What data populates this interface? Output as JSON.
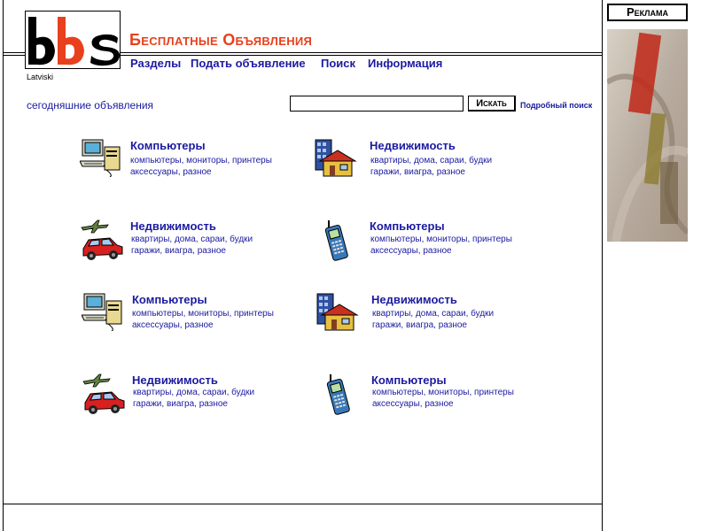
{
  "header": {
    "logo_text": "bbs",
    "site_title": "Бесплатные Объявления",
    "language": "Latviski"
  },
  "nav": [
    {
      "label": "Разделы"
    },
    {
      "label": "Подать объявление"
    },
    {
      "label": "Поиск"
    },
    {
      "label": "Информация"
    }
  ],
  "search": {
    "today_label": "сегодняшние объявления",
    "value": "",
    "button_label": "Искать",
    "advanced_label": "Подробный поиск"
  },
  "categories": [
    {
      "title": "Компьютеры",
      "line1": "компьютеры, мониторы, принтеры",
      "line2": "аксессуары, разное",
      "icon": "computer-icon"
    },
    {
      "title": "Недвижимость",
      "line1": "квартиры, дома, сараи, будки",
      "line2": "гаражи, виагра, разное",
      "icon": "house-icon"
    },
    {
      "title": "Недвижимость",
      "line1": "квартиры, дома, сараи, будки",
      "line2": "гаражи, виагра, разное",
      "icon": "car-plane-icon"
    },
    {
      "title": "Компьютеры",
      "line1": "компьютеры, мониторы, принтеры",
      "line2": "аксессуары, разное",
      "icon": "mobile-phone-icon"
    },
    {
      "title": "Компьютеры",
      "line1": "компьютеры, мониторы, принтеры",
      "line2": "аксессуары, разное",
      "icon": "computer-icon"
    },
    {
      "title": "Недвижимость",
      "line1": "квартиры, дома, сараи, будки",
      "line2": "гаражи, виагра, разное",
      "icon": "house-icon"
    },
    {
      "title": "Недвижимость",
      "line1": "квартиры, дома, сараи, будки",
      "line2": "гаражи, виагра, разное",
      "icon": "car-plane-icon"
    },
    {
      "title": "Компьютеры",
      "line1": "компьютеры, мониторы, принтеры",
      "line2": "аксессуары, разное",
      "icon": "mobile-phone-icon"
    }
  ],
  "ad": {
    "title": "Реклама"
  },
  "colors": {
    "link": "#1b1ba0",
    "title_accent": "#e8401c",
    "logo_red": "#e8401c"
  }
}
